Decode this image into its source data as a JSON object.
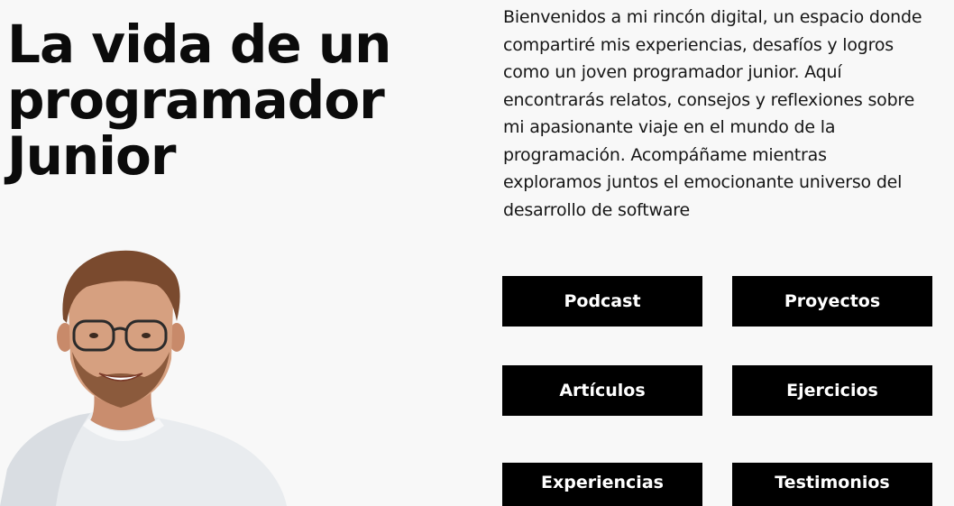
{
  "hero": {
    "title_lines": [
      "La vida de un",
      "programador",
      "Junior"
    ]
  },
  "intro": {
    "text": "Bienvenidos a mi rincón digital, un espacio donde compartiré mis experiencias, desafíos y logros como un joven programador junior. Aquí encontrarás relatos, consejos y reflexiones sobre mi apasionante viaje en el mundo de la programación. Acompáñame mientras exploramos juntos el emocionante universo del desarrollo de software"
  },
  "portrait": {
    "icon": "person-portrait"
  },
  "nav": {
    "buttons": [
      {
        "label": "Podcast"
      },
      {
        "label": "Proyectos"
      },
      {
        "label": "Artículos"
      },
      {
        "label": "Ejercicios"
      },
      {
        "label": "Experiencias"
      },
      {
        "label": "Testimonios"
      }
    ]
  },
  "colors": {
    "background": "#f8f8f8",
    "button_bg": "#000000",
    "button_text": "#ffffff",
    "text": "#111111"
  }
}
